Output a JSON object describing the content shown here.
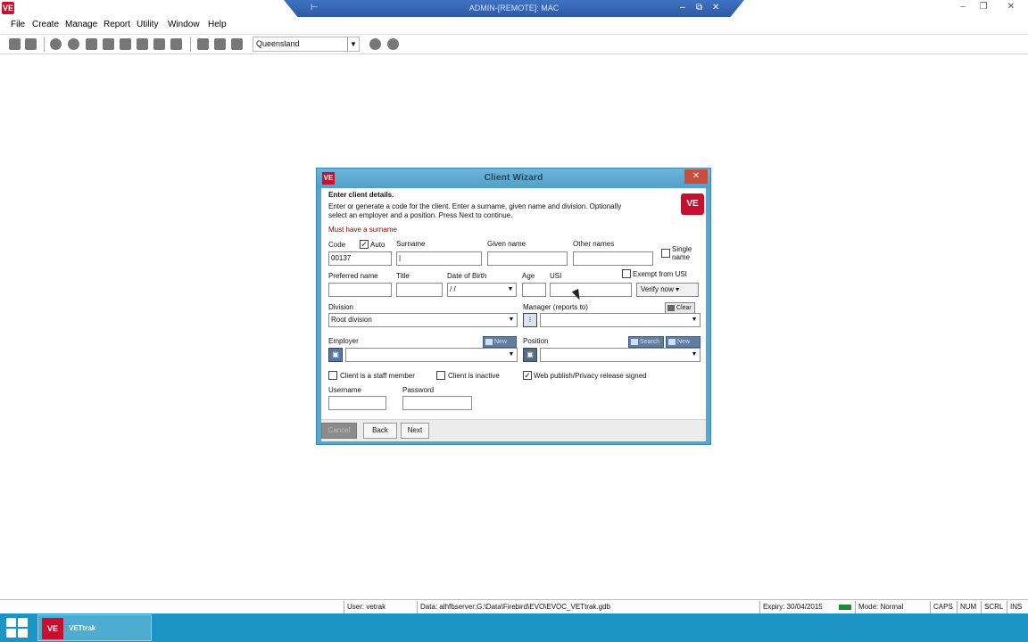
{
  "app": {
    "logo_text": "VE",
    "remote_title": "ADMIN-[REMOTE]: MAC"
  },
  "menu": [
    "File",
    "Create",
    "Manage",
    "Report",
    "Utility",
    "Window",
    "Help"
  ],
  "toolbar": {
    "state_value": "Queensland"
  },
  "dialog": {
    "title": "Client Wizard",
    "logo_text": "VE",
    "heading": "Enter client details.",
    "intro": [
      "Enter or generate a code for the client.  Enter a surname, given name and division.  Optionally",
      "select an employer and a position.  Press Next to continue."
    ],
    "error": "Must have a surname",
    "labels": {
      "code": "Code",
      "auto": "Auto",
      "surname": "Surname",
      "given_name": "Given name",
      "other_names": "Other names",
      "single_name": [
        "Single",
        "name"
      ],
      "preferred_name": "Preferred name",
      "title": "Title",
      "dob": "Date of Birth",
      "age": "Age",
      "usi": "USI",
      "exempt_usi": "Exempt from USI",
      "division": "Division",
      "manager": "Manager (reports to)",
      "employer": "Employer",
      "position": "Position",
      "staff_member": "Client is a staff member",
      "inactive": "Client is inactive",
      "web_publish": "Web publish/Privacy release signed",
      "username": "Username",
      "password": "Password"
    },
    "values": {
      "code": "00137",
      "dob": "/ /",
      "division": "Root division"
    },
    "buttons": {
      "verify": "Verify now",
      "clear": "Clear",
      "employer_new": "New",
      "position_search": "Search",
      "position_new": "New",
      "cancel": "Cancel",
      "back": "Back",
      "next": "Next"
    },
    "checks": {
      "auto": true,
      "single_name": false,
      "exempt_usi": false,
      "staff_member": false,
      "inactive": false,
      "web_publish": true
    }
  },
  "status": {
    "user": "User: vetrak",
    "data": "Data: alhfbserver:G:\\Data\\Firebird\\EVO\\EVOC_VETtrak.gdb",
    "expiry": "Expiry: 30/04/2015",
    "mode": "Mode: Normal",
    "caps": "CAPS",
    "num": "NUM",
    "scrl": "SCRL",
    "ins": "INS"
  },
  "taskbar": {
    "app_label": "VETtrak",
    "logo_text": "VE"
  }
}
